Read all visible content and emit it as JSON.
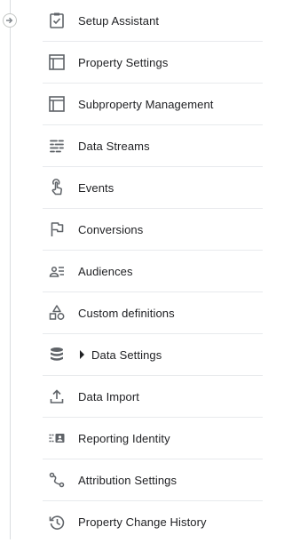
{
  "menu": {
    "items": [
      {
        "label": "Setup Assistant",
        "icon": "clipboard-check-icon"
      },
      {
        "label": "Property Settings",
        "icon": "property-layout-icon"
      },
      {
        "label": "Subproperty Management",
        "icon": "property-layout-icon"
      },
      {
        "label": "Data Streams",
        "icon": "data-streams-icon"
      },
      {
        "label": "Events",
        "icon": "touch-icon"
      },
      {
        "label": "Conversions",
        "icon": "flag-icon"
      },
      {
        "label": "Audiences",
        "icon": "audience-icon"
      },
      {
        "label": "Custom definitions",
        "icon": "shapes-icon"
      },
      {
        "label": "Data Settings",
        "icon": "database-icon",
        "expandable": true
      },
      {
        "label": "Data Import",
        "icon": "upload-icon"
      },
      {
        "label": "Reporting Identity",
        "icon": "reporting-identity-icon"
      },
      {
        "label": "Attribution Settings",
        "icon": "attribution-path-icon"
      },
      {
        "label": "Property Change History",
        "icon": "history-icon"
      }
    ]
  },
  "colors": {
    "icon": "#5f6368",
    "text": "#202124",
    "divider": "#e8eaed"
  }
}
